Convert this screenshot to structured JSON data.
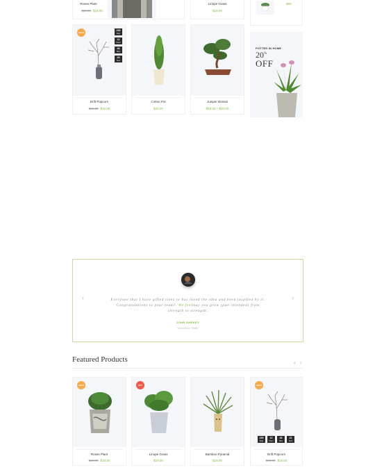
{
  "top_row": [
    {
      "name": "Roses Plant",
      "old_price": "$30.00",
      "price": "$18.00"
    },
    {
      "name": "Liriope Grass",
      "price": "$19.00"
    },
    {
      "price": "$00"
    }
  ],
  "middle_row": [
    {
      "name": "Drift Popcorn",
      "old_price": "$30.00",
      "price": "$16.00",
      "badge": "SALE",
      "countdown": [
        {
          "n": "239",
          "u": "Days"
        },
        {
          "n": "12",
          "u": "Hours"
        },
        {
          "n": "46",
          "u": "Mins"
        },
        {
          "n": "29",
          "u": "Secs"
        }
      ]
    },
    {
      "name": "Cotton Pot",
      "price": "$20.00"
    },
    {
      "name": "Juniper Bonsai",
      "price": "$18.00 – $20.00"
    }
  ],
  "promo": {
    "label": "POTTED IN HOME",
    "percent": "20",
    "percent_sign": "%",
    "off": "OFF"
  },
  "testimonial": {
    "quote_before": "Everyone that I have gifted trees to has loved the idea and been inspired by it. Congratulations to your team!. ",
    "quote_highlight": "We feel",
    "quote_after": "may you grow (pun intended) from strength to strength.",
    "author": "JOHN SHEKEY",
    "role": "WoodStore Staffs",
    "prev": "‹",
    "next": "›"
  },
  "featured": {
    "title": "Featured Products",
    "prev": "‹",
    "next": "›",
    "products": [
      {
        "name": "Roses Plant",
        "old_price": "$30.00",
        "price": "$18.00",
        "badge": "SALE",
        "badge_color": "#f6a94a"
      },
      {
        "name": "Liriope Grass",
        "price": "$19.00",
        "badge": "HOT",
        "badge_color": "#ef5a4a"
      },
      {
        "name": "Bamboo Pyramid",
        "price": "$18.00"
      },
      {
        "name": "Drift Popcorn",
        "old_price": "$30.00",
        "price": "$16.00",
        "badge": "SALE",
        "badge_color": "#f6a94a",
        "countdown": [
          {
            "n": "239",
            "u": "Days"
          },
          {
            "n": "12",
            "u": "Hours"
          },
          {
            "n": "46",
            "u": "Mins"
          },
          {
            "n": "21",
            "u": "Secs"
          }
        ]
      }
    ]
  },
  "colors": {
    "accent": "#7fba3c",
    "badge_sale": "#f6a94a",
    "badge_hot": "#ef5a4a",
    "card_bg": "#f5f6fa"
  }
}
